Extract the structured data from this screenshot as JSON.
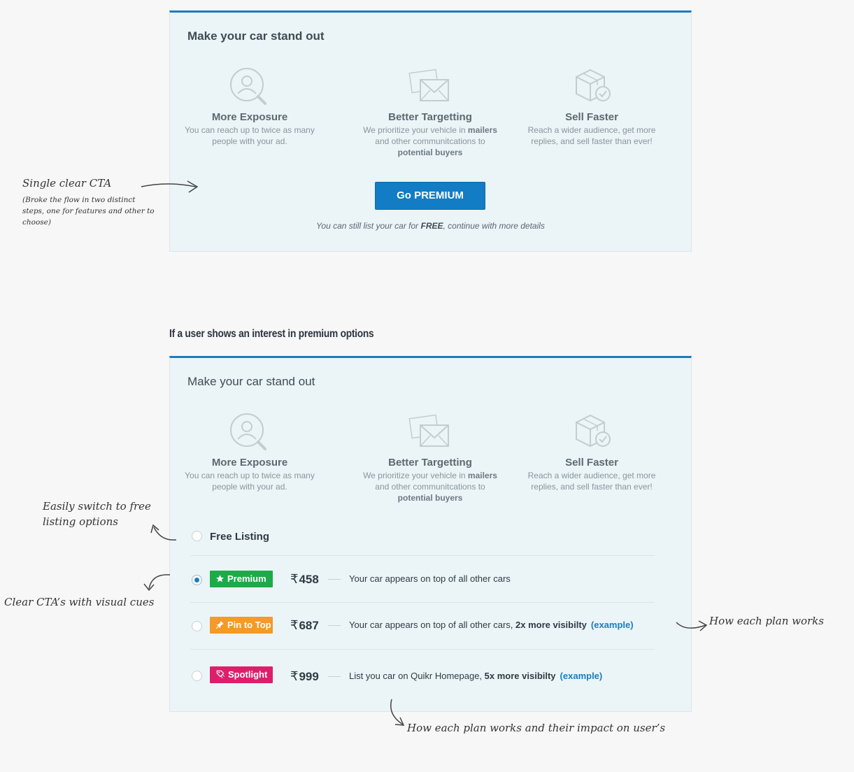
{
  "panel_top": {
    "title": "Make your car stand out",
    "features": [
      {
        "icon": "magnifier-user-icon",
        "title": "More Exposure",
        "desc": "You can reach up to twice as many people with your ad."
      },
      {
        "icon": "envelope-icon",
        "title": "Better Targetting",
        "desc_pre": "We prioritize your vehicle in ",
        "desc_b1": "mailers",
        "desc_mid": " and other communitcations to ",
        "desc_b2": "potential buyers"
      },
      {
        "icon": "box-check-icon",
        "title": "Sell Faster",
        "desc": "Reach a wider audience, get more replies, and sell faster than ever!"
      }
    ],
    "cta_label": "Go PREMIUM",
    "free_note_pre": "You can still list your car for ",
    "free_note_bold": "FREE",
    "free_note_post": ", continue with more details"
  },
  "section_heading": "If a user shows an interest in premium options",
  "panel_bottom": {
    "title": "Make your car stand out",
    "free_listing_label": "Free Listing",
    "plans": [
      {
        "badge": "Premium",
        "badge_color": "#1faa4a",
        "icon": "star-icon",
        "currency": "₹",
        "price": "458",
        "desc": "Your car appears on top of all other cars",
        "desc_bold": "",
        "example": "",
        "selected": true
      },
      {
        "badge": "Pin to Top",
        "badge_color": "#f39a27",
        "icon": "pin-icon",
        "currency": "₹",
        "price": "687",
        "desc": "Your car appears on top of all other cars, ",
        "desc_bold": "2x more visibilty",
        "example": "(example)",
        "selected": false
      },
      {
        "badge": "Spotlight",
        "badge_color": "#dd1f6b",
        "icon": "spotlight-icon",
        "currency": "₹",
        "price": "999",
        "desc": "List you car on Quikr Homepage, ",
        "desc_bold": "5x more visibilty",
        "example": "(example)",
        "selected": false
      }
    ]
  },
  "annotations": {
    "cta_title": "Single clear CTA",
    "cta_sub_1": "(Broke the flow in two distinct",
    "cta_sub_2": "steps, one for features and other to",
    "cta_sub_3": "choose)",
    "switch_1": "Easily switch to free",
    "switch_2": "listing options",
    "visual_cues": "Clear CTA’s with visual cues",
    "plan_works": "How each plan works",
    "impact": "How each plan works and their impact on user’s"
  },
  "colors": {
    "accent": "#1a7cc1",
    "panel_bg": "#ebf5f7",
    "premium": "#1faa4a",
    "pin": "#f39a27",
    "spotlight": "#dd1f6b"
  }
}
